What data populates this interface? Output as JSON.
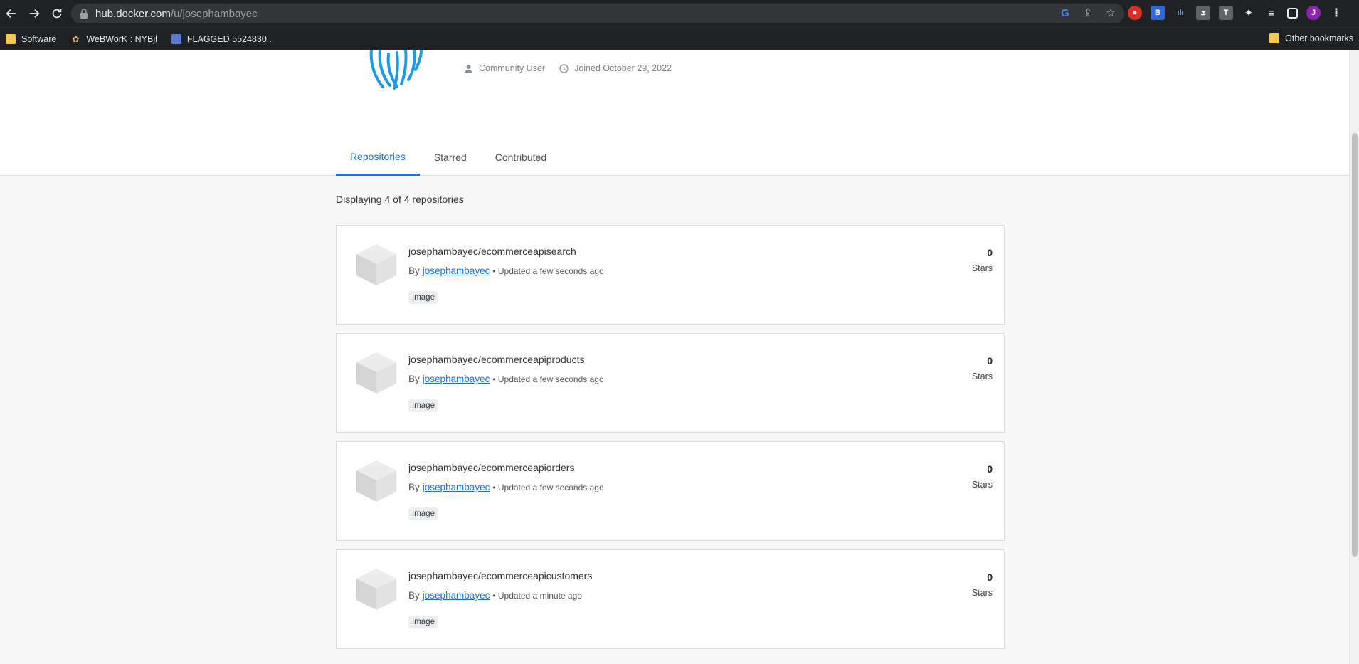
{
  "browser": {
    "url_host": "hub.docker.com",
    "url_path": "/u/josephambayec",
    "bookmarks": [
      {
        "label": "Software",
        "icon": "folder-icon"
      },
      {
        "label": "WeBWorK : NYBjl",
        "icon": "webwork-icon"
      },
      {
        "label": "FLAGGED 5524830...",
        "icon": "site-icon"
      }
    ],
    "other_bookmarks": "Other bookmarks"
  },
  "profile": {
    "role": "Community User",
    "joined": "Joined October 29, 2022"
  },
  "tabs": [
    {
      "label": "Repositories",
      "active": true
    },
    {
      "label": "Starred",
      "active": false
    },
    {
      "label": "Contributed",
      "active": false
    }
  ],
  "count_text": "Displaying 4 of 4 repositories",
  "by_prefix": "By",
  "stars_label": "Stars",
  "repos": [
    {
      "name": "josephambayec/ecommerceapisearch",
      "owner": "josephambayec",
      "updated": "• Updated a few seconds ago",
      "type": "Image",
      "stars": "0"
    },
    {
      "name": "josephambayec/ecommerceapiproducts",
      "owner": "josephambayec",
      "updated": "• Updated a few seconds ago",
      "type": "Image",
      "stars": "0"
    },
    {
      "name": "josephambayec/ecommerceapiorders",
      "owner": "josephambayec",
      "updated": "• Updated a few seconds ago",
      "type": "Image",
      "stars": "0"
    },
    {
      "name": "josephambayec/ecommerceapicustomers",
      "owner": "josephambayec",
      "updated": "• Updated a minute ago",
      "type": "Image",
      "stars": "0"
    }
  ],
  "colors": {
    "accent": "#1f6fd0",
    "chrome": "#202124",
    "fingerprint": "#1d9be6"
  }
}
